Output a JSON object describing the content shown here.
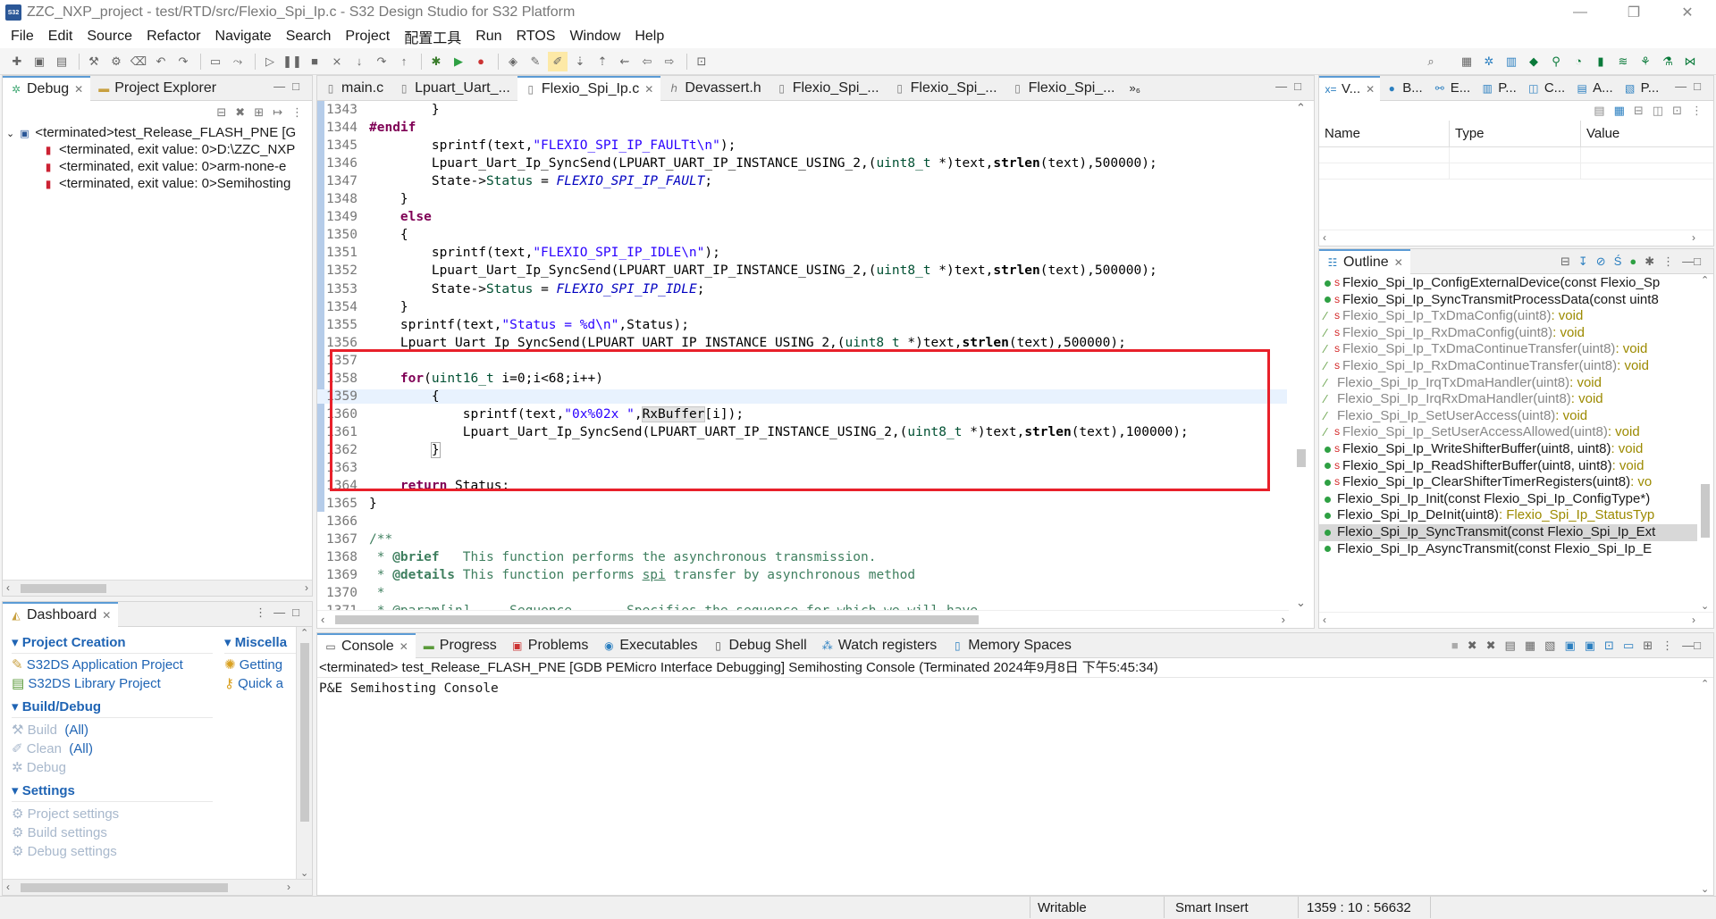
{
  "window": {
    "title": "ZZC_NXP_project - test/RTD/src/Flexio_Spi_Ip.c - S32 Design Studio for S32 Platform",
    "app_icon": "S32"
  },
  "menu": [
    "File",
    "Edit",
    "Source",
    "Refactor",
    "Navigate",
    "Search",
    "Project",
    "配置工具",
    "Run",
    "RTOS",
    "Window",
    "Help"
  ],
  "debug_panel": {
    "tabs": [
      {
        "label": "Debug",
        "icon": "bug-icon"
      },
      {
        "label": "Project Explorer",
        "icon": "folder-icon"
      }
    ],
    "tree": [
      {
        "label": "<terminated>test_Release_FLASH_PNE [G",
        "level": 0
      },
      {
        "label": "<terminated, exit value: 0>D:\\ZZC_NXP",
        "level": 1
      },
      {
        "label": "<terminated, exit value: 0>arm-none-e",
        "level": 1
      },
      {
        "label": "<terminated, exit value: 0>Semihosting",
        "level": 1
      }
    ]
  },
  "dashboard": {
    "tab": "Dashboard",
    "sections": [
      {
        "title": "Project Creation",
        "items": [
          {
            "label": "S32DS Application Project",
            "enabled": true
          },
          {
            "label": "S32DS Library Project",
            "enabled": true
          }
        ]
      },
      {
        "title": "Build/Debug",
        "items": [
          {
            "label": "Build",
            "suffix": "(All)",
            "enabled": false
          },
          {
            "label": "Clean",
            "suffix": "(All)",
            "enabled": false
          },
          {
            "label": "Debug",
            "suffix": "",
            "enabled": false
          }
        ]
      },
      {
        "title": "Settings",
        "items": [
          {
            "label": "Project settings",
            "enabled": false
          },
          {
            "label": "Build settings",
            "enabled": false
          },
          {
            "label": "Debug settings",
            "enabled": false
          }
        ]
      }
    ],
    "misc_title": "Miscella",
    "misc_items": [
      "Getting",
      "Quick a"
    ]
  },
  "editor": {
    "tabs": [
      {
        "label": "main.c",
        "active": false
      },
      {
        "label": "Lpuart_Uart_...",
        "active": false
      },
      {
        "label": "Flexio_Spi_Ip.c",
        "active": true
      },
      {
        "label": "Devassert.h",
        "active": false
      },
      {
        "label": "Flexio_Spi_...",
        "active": false
      },
      {
        "label": "Flexio_Spi_...",
        "active": false
      },
      {
        "label": "Flexio_Spi_...",
        "active": false
      }
    ],
    "overflow": "»₆",
    "lines": [
      {
        "n": "1343",
        "html": "        }"
      },
      {
        "n": "1344",
        "html": "<span class='kw'>#endif</span>"
      },
      {
        "n": "1345",
        "html": "        sprintf(text,<span class='str'>\"FLEXIO_SPI_IP_FAULTt\\n\"</span>);"
      },
      {
        "n": "1346",
        "html": "        Lpuart_Uart_Ip_SyncSend(LPUART_UART_IP_INSTANCE_USING_2,(<span class='tdef'>uint8_t</span> *)text,<span class='fn'>strlen</span>(text),500000);"
      },
      {
        "n": "1347",
        "html": "        State-><span class='tdef'>Status</span> = <span class='macro'>FLEXIO_SPI_IP_FAULT</span>;"
      },
      {
        "n": "1348",
        "html": "    }"
      },
      {
        "n": "1349",
        "html": "    <span class='kw'>else</span>"
      },
      {
        "n": "1350",
        "html": "    {"
      },
      {
        "n": "1351",
        "html": "        sprintf(text,<span class='str'>\"FLEXIO_SPI_IP_IDLE\\n\"</span>);"
      },
      {
        "n": "1352",
        "html": "        Lpuart_Uart_Ip_SyncSend(LPUART_UART_IP_INSTANCE_USING_2,(<span class='tdef'>uint8_t</span> *)text,<span class='fn'>strlen</span>(text),500000);"
      },
      {
        "n": "1353",
        "html": "        State-><span class='tdef'>Status</span> = <span class='macro'>FLEXIO_SPI_IP_IDLE</span>;"
      },
      {
        "n": "1354",
        "html": "    }"
      },
      {
        "n": "1355",
        "html": "    sprintf(text,<span class='str'>\"Status = %d\\n\"</span>,Status);"
      },
      {
        "n": "1356",
        "html": "    Lpuart_Uart_Ip_SyncSend(LPUART_UART_IP_INSTANCE_USING_2,(<span class='tdef'>uint8_t</span> *)text,<span class='fn'>strlen</span>(text),500000);"
      },
      {
        "n": "1357",
        "html": ""
      },
      {
        "n": "1358",
        "html": "    <span class='kw'>for</span>(<span class='tdef'>uint16_t</span> i=0;i<68;i++)"
      },
      {
        "n": "1359",
        "html": "        {",
        "hl": true
      },
      {
        "n": "1360",
        "html": "            sprintf(text,<span class='str'>\"0x%02x \"</span>,<span style='background:#e4e4e4;outline:1px solid #c8c8c8'>RxBuffer</span>[i]);"
      },
      {
        "n": "1361",
        "html": "            Lpuart_Uart_Ip_SyncSend(LPUART_UART_IP_INSTANCE_USING_2,(<span class='tdef'>uint8_t</span> *)text,<span class='fn'>strlen</span>(text),100000);"
      },
      {
        "n": "1362",
        "html": "        <span style='outline:1px solid #aaa'>}</span>"
      },
      {
        "n": "1363",
        "html": ""
      },
      {
        "n": "1364",
        "html": "    <span class='kw'>return</span> Status;"
      },
      {
        "n": "1365",
        "html": "}"
      },
      {
        "n": "1366",
        "html": ""
      },
      {
        "n": "1367",
        "html": "<span class='cmt'>/**</span>"
      },
      {
        "n": "1368",
        "html": "<span class='cmt'> * <b>@brief</b>   This function performs the asynchronous transmission.</span>"
      },
      {
        "n": "1369",
        "html": "<span class='cmt'> * <b>@details</b> This function performs <u>spi</u> transfer by asynchronous method</span>"
      },
      {
        "n": "1370",
        "html": "<span class='cmt'> *</span>"
      },
      {
        "n": "1371",
        "html": "<span class='cmt'> * @param[in]     Sequence       Specifies the sequence for which we will have</span>"
      }
    ]
  },
  "variables_panel": {
    "tabs": [
      "V...",
      "B...",
      "E...",
      "P...",
      "C...",
      "A...",
      "P..."
    ],
    "columns": [
      "Name",
      "Type",
      "Value"
    ]
  },
  "outline": {
    "tab": "Outline",
    "items": [
      {
        "label": "Flexio_Spi_Ip_ConfigExternalDevice(const Flexio_Sp",
        "ret": "",
        "static": true,
        "active": true
      },
      {
        "label": "Flexio_Spi_Ip_SyncTransmitProcessData(const uint8",
        "ret": "",
        "static": true,
        "active": true
      },
      {
        "label": "Flexio_Spi_Ip_TxDmaConfig(uint8)",
        "ret": " : void",
        "static": true,
        "active": false
      },
      {
        "label": "Flexio_Spi_Ip_RxDmaConfig(uint8)",
        "ret": " : void",
        "static": true,
        "active": false
      },
      {
        "label": "Flexio_Spi_Ip_TxDmaContinueTransfer(uint8)",
        "ret": " : void",
        "static": true,
        "active": false
      },
      {
        "label": "Flexio_Spi_Ip_RxDmaContinueTransfer(uint8)",
        "ret": " : void",
        "static": true,
        "active": false
      },
      {
        "label": "Flexio_Spi_Ip_IrqTxDmaHandler(uint8)",
        "ret": " : void",
        "static": false,
        "active": false
      },
      {
        "label": "Flexio_Spi_Ip_IrqRxDmaHandler(uint8)",
        "ret": " : void",
        "static": false,
        "active": false
      },
      {
        "label": "Flexio_Spi_Ip_SetUserAccess(uint8)",
        "ret": " : void",
        "static": false,
        "active": false
      },
      {
        "label": "Flexio_Spi_Ip_SetUserAccessAllowed(uint8)",
        "ret": " : void",
        "static": true,
        "active": false
      },
      {
        "label": "Flexio_Spi_Ip_WriteShifterBuffer(uint8, uint8)",
        "ret": " : void",
        "static": true,
        "active": true
      },
      {
        "label": "Flexio_Spi_Ip_ReadShifterBuffer(uint8, uint8)",
        "ret": " : void",
        "static": true,
        "active": true
      },
      {
        "label": "Flexio_Spi_Ip_ClearShifterTimerRegisters(uint8)",
        "ret": " : vo",
        "static": true,
        "active": true
      },
      {
        "label": "Flexio_Spi_Ip_Init(const Flexio_Spi_Ip_ConfigType*)",
        "ret": "",
        "static": false,
        "active": true
      },
      {
        "label": "Flexio_Spi_Ip_DeInit(uint8)",
        "ret": " : Flexio_Spi_Ip_StatusTyp",
        "static": false,
        "active": true
      },
      {
        "label": "Flexio_Spi_Ip_SyncTransmit(const Flexio_Spi_Ip_Ext",
        "ret": "",
        "static": false,
        "active": true,
        "selected": true
      },
      {
        "label": "Flexio_Spi_Ip_AsyncTransmit(const Flexio_Spi_Ip_E",
        "ret": "",
        "static": false,
        "active": true
      }
    ]
  },
  "console": {
    "tabs": [
      {
        "label": "Console",
        "icon": "console-icon",
        "active": true
      },
      {
        "label": "Progress",
        "icon": "progress-icon"
      },
      {
        "label": "Problems",
        "icon": "problems-icon"
      },
      {
        "label": "Executables",
        "icon": "executables-icon"
      },
      {
        "label": "Debug Shell",
        "icon": "debug-shell-icon"
      },
      {
        "label": "Watch registers",
        "icon": "watch-registers-icon"
      },
      {
        "label": "Memory Spaces",
        "icon": "memory-icon"
      }
    ],
    "status_line": "<terminated> test_Release_FLASH_PNE [GDB PEMicro Interface Debugging] Semihosting Console (Terminated 2024年9月8日 下午5:45:34)",
    "output": "P&E Semihosting Console"
  },
  "statusbar": {
    "mode": "Writable",
    "insert": "Smart Insert",
    "position": "1359 : 10 : 56632"
  },
  "colors": {
    "highlight_box": "#e8202a",
    "accent": "#1f64b4"
  }
}
